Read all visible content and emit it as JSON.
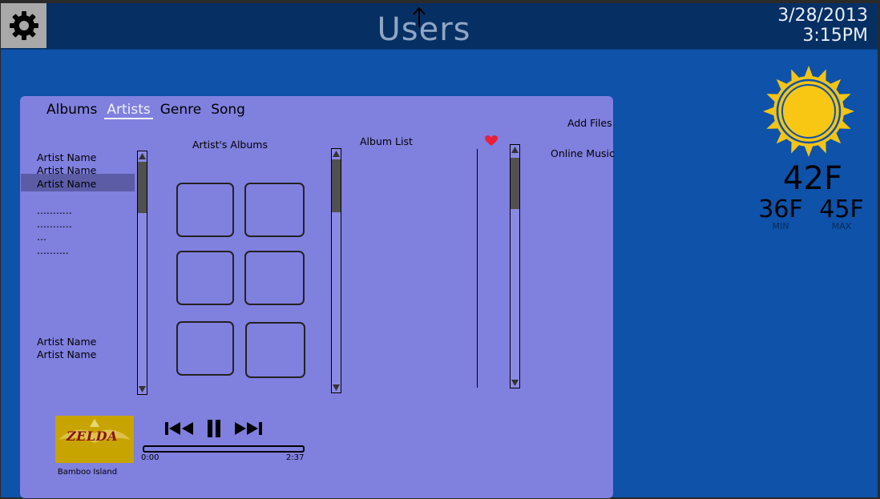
{
  "header": {
    "title": "Users",
    "date": "3/28/2013",
    "time": "3:15PM"
  },
  "weather": {
    "temp": "42F",
    "min_temp": "36F",
    "min_label": "MIN",
    "max_temp": "45F",
    "max_label": "MAX",
    "icon": "sun-icon"
  },
  "tabs": [
    "Albums",
    "Artists",
    "Genre",
    "Song"
  ],
  "active_tab": "Artists",
  "artists_column": {
    "items": [
      "Artist Name",
      "Artist Name",
      "Artist Name",
      "...........",
      "...........",
      "...",
      ".........."
    ],
    "bottom_items": [
      "Artist Name",
      "Artist Name"
    ]
  },
  "albums_section": {
    "title": "Artist's Albums"
  },
  "album_list": {
    "title": "Album List"
  },
  "actions": {
    "add_files": "Add Files",
    "online_music": "Online Music"
  },
  "player": {
    "cover_title": "ZELDA",
    "track": "Bamboo Island",
    "elapsed": "0:00",
    "duration": "2:37",
    "progress": 0
  },
  "colors": {
    "background": "#0e52a9",
    "topbar": "#062f63",
    "panel": "#8080df",
    "sun": "#f3c417",
    "heart": "#e8203a"
  }
}
